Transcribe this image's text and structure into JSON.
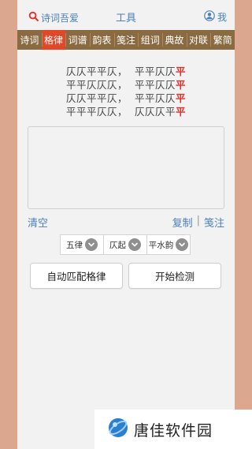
{
  "header": {
    "brand_label": "诗词吾爱",
    "title": "工具",
    "me_label": "我"
  },
  "tabs": [
    {
      "label": "诗词",
      "active": false
    },
    {
      "label": "格律",
      "active": true
    },
    {
      "label": "词谱",
      "active": false
    },
    {
      "label": "韵表",
      "active": false
    },
    {
      "label": "笺注",
      "active": false
    },
    {
      "label": "组词",
      "active": false
    },
    {
      "label": "典故",
      "active": false
    },
    {
      "label": "对联",
      "active": false
    },
    {
      "label": "繁简",
      "active": false
    }
  ],
  "pattern": {
    "lines": [
      {
        "first": "仄仄平平仄，",
        "second": "平平仄仄",
        "rhyme": "平"
      },
      {
        "first": "平平仄仄仄，",
        "second": "平平仄仄",
        "rhyme": "平"
      },
      {
        "first": "仄仄平平仄，",
        "second": "平平仄仄",
        "rhyme": "平"
      },
      {
        "first": "平平平仄仄，",
        "second": "仄仄仄平",
        "rhyme": "平"
      }
    ]
  },
  "actions": {
    "clear": "清空",
    "copy": "复制",
    "separator": "|",
    "annotate": "笺注"
  },
  "selectors": [
    {
      "value": "五律"
    },
    {
      "value": "仄起"
    },
    {
      "value": "平水韵"
    }
  ],
  "buttons": {
    "auto_match": "自动匹配格律",
    "start_check": "开始检测"
  },
  "watermark": {
    "text": "唐佳软件园"
  },
  "colors": {
    "accent_blue": "#4a80b8",
    "tab_bar": "#8a6a40",
    "tab_active": "#e0482a",
    "rhyme_red": "#e0302a",
    "side_background": "#dba88f"
  }
}
